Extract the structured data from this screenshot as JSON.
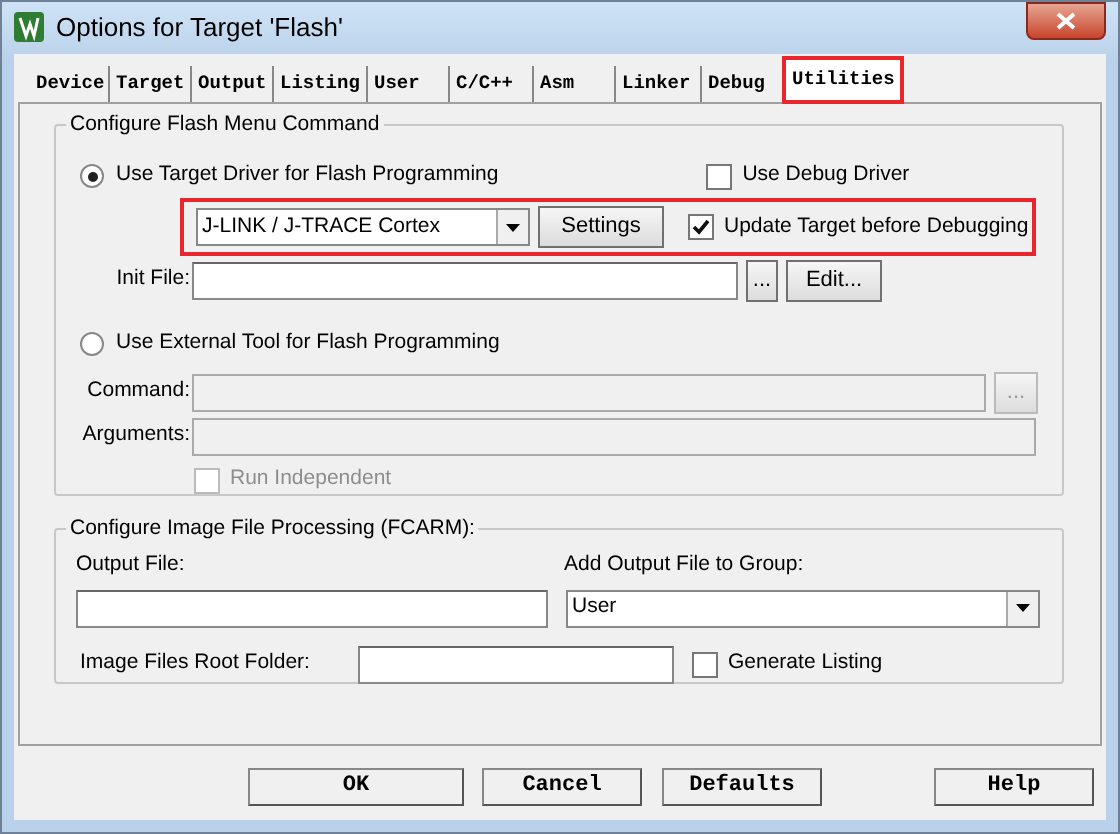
{
  "window": {
    "title": "Options for Target 'Flash'"
  },
  "tabs": [
    {
      "label": "Device",
      "selected": false,
      "highlighted": false
    },
    {
      "label": "Target",
      "selected": false,
      "highlighted": false
    },
    {
      "label": "Output",
      "selected": false,
      "highlighted": false
    },
    {
      "label": "Listing",
      "selected": false,
      "highlighted": false
    },
    {
      "label": "User",
      "selected": false,
      "highlighted": false
    },
    {
      "label": "C/C++",
      "selected": false,
      "highlighted": false
    },
    {
      "label": "Asm",
      "selected": false,
      "highlighted": false
    },
    {
      "label": "Linker",
      "selected": false,
      "highlighted": false
    },
    {
      "label": "Debug",
      "selected": false,
      "highlighted": false
    },
    {
      "label": "Utilities",
      "selected": true,
      "highlighted": true
    }
  ],
  "flash_group": {
    "title": "Configure Flash Menu Command",
    "options": [
      {
        "label": "Use Target Driver for Flash Programming",
        "selected": true
      },
      {
        "label": "Use External Tool for Flash Programming",
        "selected": false
      }
    ],
    "use_debug_driver": {
      "label": "Use Debug Driver",
      "checked": false
    },
    "driver_row": {
      "highlighted": true,
      "driver": "J-LINK / J-TRACE Cortex",
      "settings_button": "Settings",
      "update_target": {
        "label": "Update Target before Debugging",
        "checked": true
      }
    },
    "init_file": {
      "label": "Init File:",
      "browse_button": "...",
      "edit_button": "Edit..."
    },
    "command": {
      "label": "Command:",
      "disabled": true,
      "browse_button": "..."
    },
    "arguments": {
      "label": "Arguments:",
      "disabled": true
    },
    "run_independent": {
      "label": "Run Independent",
      "checked": false,
      "disabled": true
    }
  },
  "image_group": {
    "title": "Configure Image File Processing (FCARM):",
    "output_file": {
      "label": "Output File:"
    },
    "group": {
      "label": "Add Output File  to Group:",
      "value": "User"
    },
    "root_folder": {
      "label": "Image Files Root Folder:"
    },
    "generate_listing": {
      "label": "Generate Listing",
      "checked": false
    }
  },
  "buttons": [
    "OK",
    "Cancel",
    "Defaults",
    "Help"
  ]
}
